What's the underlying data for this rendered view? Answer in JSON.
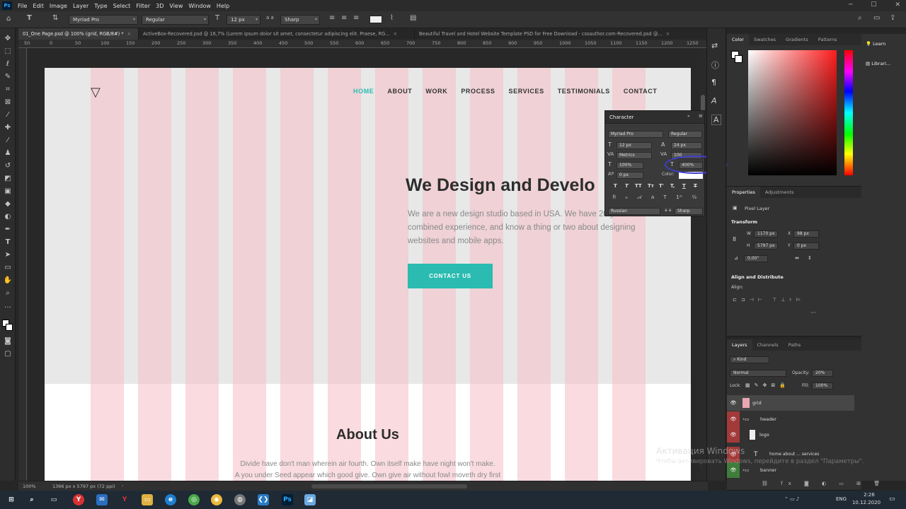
{
  "menu": {
    "ps_logo": "Ps",
    "items": [
      "File",
      "Edit",
      "Image",
      "Layer",
      "Type",
      "Select",
      "Filter",
      "3D",
      "View",
      "Window",
      "Help"
    ]
  },
  "options": {
    "font": "Myriad Pro",
    "style": "Regular",
    "size": "12 px",
    "aa_label": "a a",
    "aa": "Sharp"
  },
  "tabs": [
    {
      "label": "01_One Page.psd @ 100% (grid, RGB/8#) *"
    },
    {
      "label": "ActiveBox-Recovered.psd @ 16,7% (Lorem ipsum dolor sit amet, consectetur adipiscing elit. Praese, RG..."
    },
    {
      "label": "Beautiful Travel and Hotel Website Template PSD for Free Download - cssauthor.com-Recovered.psd @..."
    }
  ],
  "ruler_top": [
    "50",
    "0",
    "50",
    "100",
    "150",
    "200",
    "250",
    "300",
    "350",
    "400",
    "450",
    "500",
    "550",
    "600",
    "650",
    "700",
    "750",
    "800",
    "850",
    "900",
    "950",
    "1000",
    "1050",
    "1100",
    "1150",
    "1200",
    "1250"
  ],
  "site": {
    "nav": [
      "HOME",
      "ABOUT",
      "WORK",
      "PROCESS",
      "SERVICES",
      "TESTIMONIALS",
      "CONTACT"
    ],
    "hero_title": "We Design and Develo",
    "hero_text": "We are a new design studio based in USA. We have 20 years of combined experience, and know a thing or two about designing websites and mobile apps.",
    "cta": "CONTACT US",
    "about_title": "About Us",
    "about_line1": "Divide have don't man wherein air fourth. Own itself make have night won't make.",
    "about_line2": "A you under Seed appear which good give. Own give air without fowl moveth dry first"
  },
  "character": {
    "title": "Character",
    "font": "Myriad Pro",
    "style": "Regular",
    "size": "12 px",
    "leading": "24 px",
    "kerning": "Metrics",
    "tracking": "100",
    "vscale": "100%",
    "hscale": "400%",
    "baseline": "0 px",
    "color_label": "Color:",
    "language": "Russian",
    "aa": "Sharp",
    "type_buttons": [
      "T",
      "T",
      "TT",
      "Tт",
      "T'",
      "T,",
      "T",
      "T"
    ]
  },
  "status": {
    "zoom": "100%",
    "doc": "1366 px x 5797 px (72 ppi)"
  },
  "color_panel": {
    "tabs": [
      "Color",
      "Swatches",
      "Gradients",
      "Patterns"
    ]
  },
  "learn": {
    "learn": "Learn",
    "libraries": "Librari..."
  },
  "properties": {
    "tabs": [
      "Properties",
      "Adjustments"
    ],
    "kind": "Pixel Layer",
    "transform": "Transform",
    "w_label": "W",
    "w": "1170 px",
    "x_label": "X",
    "x": "98 px",
    "h_label": "H",
    "h": "5797 px",
    "y_label": "Y",
    "y": "0 px",
    "angle": "0,00°",
    "align": "Align and Distribute",
    "align_label": "Align:"
  },
  "layers": {
    "tabs": [
      "Layers",
      "Channels",
      "Paths"
    ],
    "kind": "Kind",
    "blend": "Normal",
    "opacity_label": "Opacity:",
    "opacity": "20%",
    "lock_label": "Lock:",
    "fill_label": "Fill:",
    "fill": "100%",
    "rows": [
      {
        "name": "grid"
      },
      {
        "name": "header"
      },
      {
        "name": "logo"
      },
      {
        "name": "home    about    ...    services"
      },
      {
        "name": "banner"
      }
    ]
  },
  "watermark": {
    "line1": "Активация Windows",
    "line2": "Чтобы активировать Windows, перейдите в раздел \"Параметры\"."
  },
  "taskbar": {
    "lang": "ENG",
    "time": "2:26",
    "date": "10.12.2020"
  }
}
